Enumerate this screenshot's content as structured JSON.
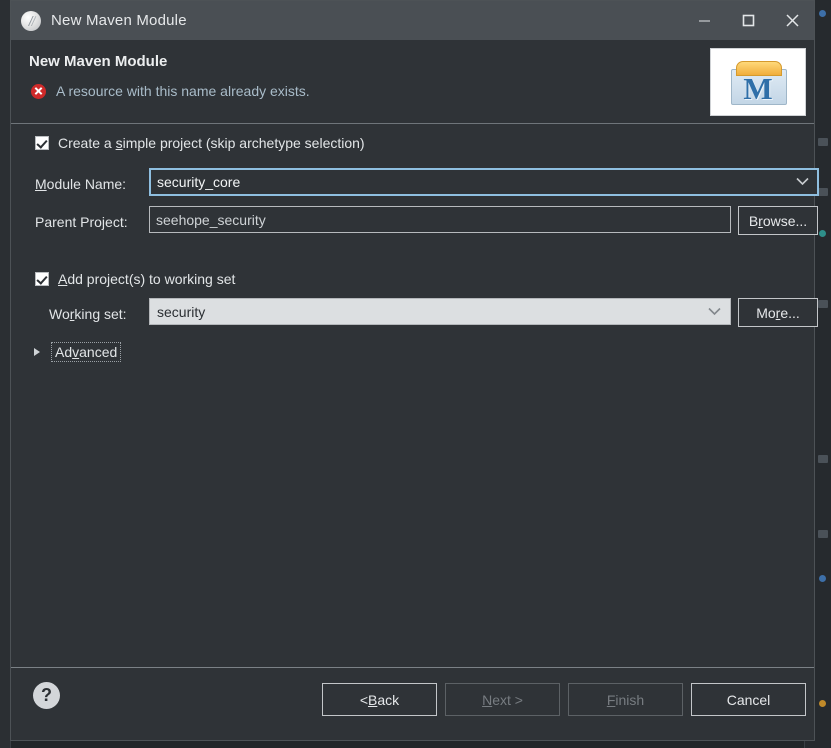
{
  "window": {
    "title": "New Maven Module",
    "icon": "maven-feather-icon",
    "controls": {
      "minimize": "minimize-icon",
      "maximize": "maximize-icon",
      "close": "close-icon"
    }
  },
  "header": {
    "title": "New Maven Module",
    "message": "A resource with this name already exists.",
    "message_icon": "error-icon",
    "logo": "maven-folder-icon",
    "logo_letter": "M"
  },
  "form": {
    "simple_project": {
      "label_prefix": "Create a ",
      "label_mnemonic": "s",
      "label_suffix": "imple project (skip archetype selection)",
      "label_full": "Create a simple project (skip archetype selection)",
      "checked": true
    },
    "module_name": {
      "label_prefix": "",
      "label_mnemonic": "M",
      "label_suffix": "odule Name:",
      "label_full": "Module Name:",
      "value": "security_core",
      "focused": true
    },
    "parent_project": {
      "label_full": "Parent Project:",
      "value": "seehope_security",
      "browse_label_prefix": "B",
      "browse_label_mnemonic": "r",
      "browse_label_suffix": "owse...",
      "browse_label_full": "Browse..."
    },
    "add_to_working_set": {
      "label_prefix": "",
      "label_mnemonic": "A",
      "label_suffix": "dd project(s) to working set",
      "label_full": "Add project(s) to working set",
      "checked": true
    },
    "working_set": {
      "label_prefix": "Wo",
      "label_mnemonic": "r",
      "label_suffix": "king set:",
      "label_full": "Working set:",
      "value": "security",
      "more_label_prefix": "Mo",
      "more_label_mnemonic": "r",
      "more_label_suffix": "e...",
      "more_label_full": "More..."
    },
    "advanced": {
      "label_prefix": "Ad",
      "label_mnemonic": "v",
      "label_suffix": "anced",
      "label_full": "Advanced",
      "expanded": false
    }
  },
  "footer": {
    "help": "?",
    "buttons": [
      {
        "name": "back",
        "prefix": "< ",
        "mnemonic": "B",
        "suffix": "ack",
        "full": "< Back",
        "disabled": false
      },
      {
        "name": "next",
        "prefix": "",
        "mnemonic": "N",
        "suffix": "ext >",
        "full": "Next >",
        "disabled": true
      },
      {
        "name": "finish",
        "prefix": "",
        "mnemonic": "F",
        "suffix": "inish",
        "full": "Finish",
        "disabled": true
      },
      {
        "name": "cancel",
        "prefix": "",
        "mnemonic": "",
        "suffix": "Cancel",
        "full": "Cancel",
        "disabled": false
      }
    ]
  },
  "colors": {
    "titlebar": "#4a4f54",
    "dialog_bg": "#2f3337",
    "error_red": "#cf2a2a",
    "focus_blue": "#8fbfe0",
    "message_text": "#a9bcc9",
    "light_combo_bg": "#dcdfe1"
  }
}
